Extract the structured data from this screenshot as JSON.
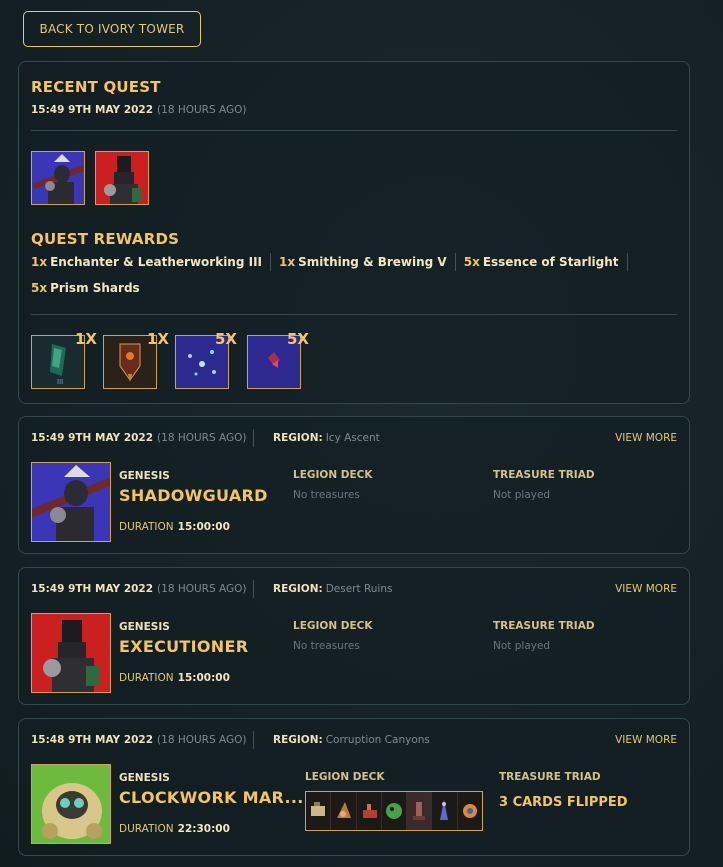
{
  "back_button": "BACK TO IVORY TOWER",
  "recent_quest": {
    "title": "RECENT QUEST",
    "timestamp": "15:49 9TH MAY 2022",
    "ago": "(18 HOURS AGO)",
    "rewards_title": "QUEST REWARDS",
    "rewards": [
      {
        "qty": "1x",
        "name": "Enchanter & Leatherworking III"
      },
      {
        "qty": "1x",
        "name": "Smithing & Brewing V"
      },
      {
        "qty": "5x",
        "name": "Essence of Starlight"
      },
      {
        "qty": "5x",
        "name": "Prism Shards"
      }
    ],
    "reward_counts": [
      "1X",
      "1X",
      "5X",
      "5X"
    ]
  },
  "quests": [
    {
      "timestamp": "15:49 9TH MAY 2022",
      "ago": "(18 HOURS AGO)",
      "region_label": "REGION:",
      "region": "Icy Ascent",
      "view_more": "VIEW MORE",
      "genesis": "GENESIS",
      "name": "SHADOWGUARD",
      "duration_label": "DURATION",
      "duration": "15:00:00",
      "deck_label": "LEGION DECK",
      "deck_value": "No treasures",
      "triad_label": "TREASURE TRIAD",
      "triad_value": "Not played"
    },
    {
      "timestamp": "15:49 9TH MAY 2022",
      "ago": "(18 HOURS AGO)",
      "region_label": "REGION:",
      "region": "Desert Ruins",
      "view_more": "VIEW MORE",
      "genesis": "GENESIS",
      "name": "EXECUTIONER",
      "duration_label": "DURATION",
      "duration": "15:00:00",
      "deck_label": "LEGION DECK",
      "deck_value": "No treasures",
      "triad_label": "TREASURE TRIAD",
      "triad_value": "Not played"
    },
    {
      "timestamp": "15:48 9TH MAY 2022",
      "ago": "(18 HOURS AGO)",
      "region_label": "REGION:",
      "region": "Corruption Canyons",
      "view_more": "VIEW MORE",
      "genesis": "GENESIS",
      "name": "CLOCKWORK MAR...",
      "duration_label": "DURATION",
      "duration": "22:30:00",
      "deck_label": "LEGION DECK",
      "triad_label": "TREASURE TRIAD",
      "triad_value": "3 CARDS FLIPPED"
    }
  ]
}
